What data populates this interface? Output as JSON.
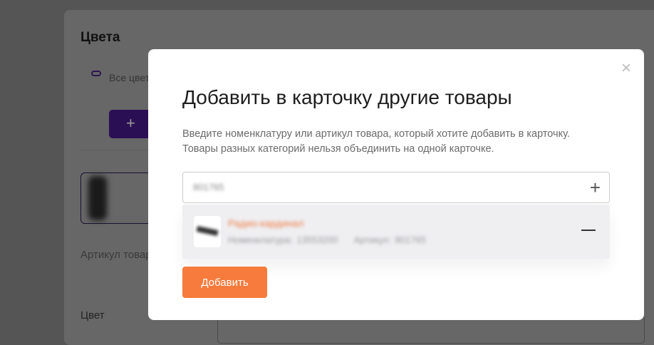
{
  "background": {
    "section_title": "Цвета",
    "link_text": "Все цвета доступны товарам",
    "add_button_icon": "+",
    "article_label": "Артикул товара",
    "color_label": "Цвет"
  },
  "modal": {
    "title": "Добавить в карточку другие товары",
    "description": "Введите номенклатуру или артикул товара, который хотите добавить в карточку. Товары разных категорий нельзя объединить на одной карточке.",
    "input_value": "801765",
    "plus_icon": "+",
    "close_icon": "×",
    "result": {
      "name": "Радио-кардинал",
      "nomenclature": "Номенклатура: 13553200",
      "article": "Артикул: 801765"
    },
    "add_button": "Добавить"
  },
  "colors": {
    "accent": "#f77b3c",
    "purple": "#2b0f55"
  }
}
